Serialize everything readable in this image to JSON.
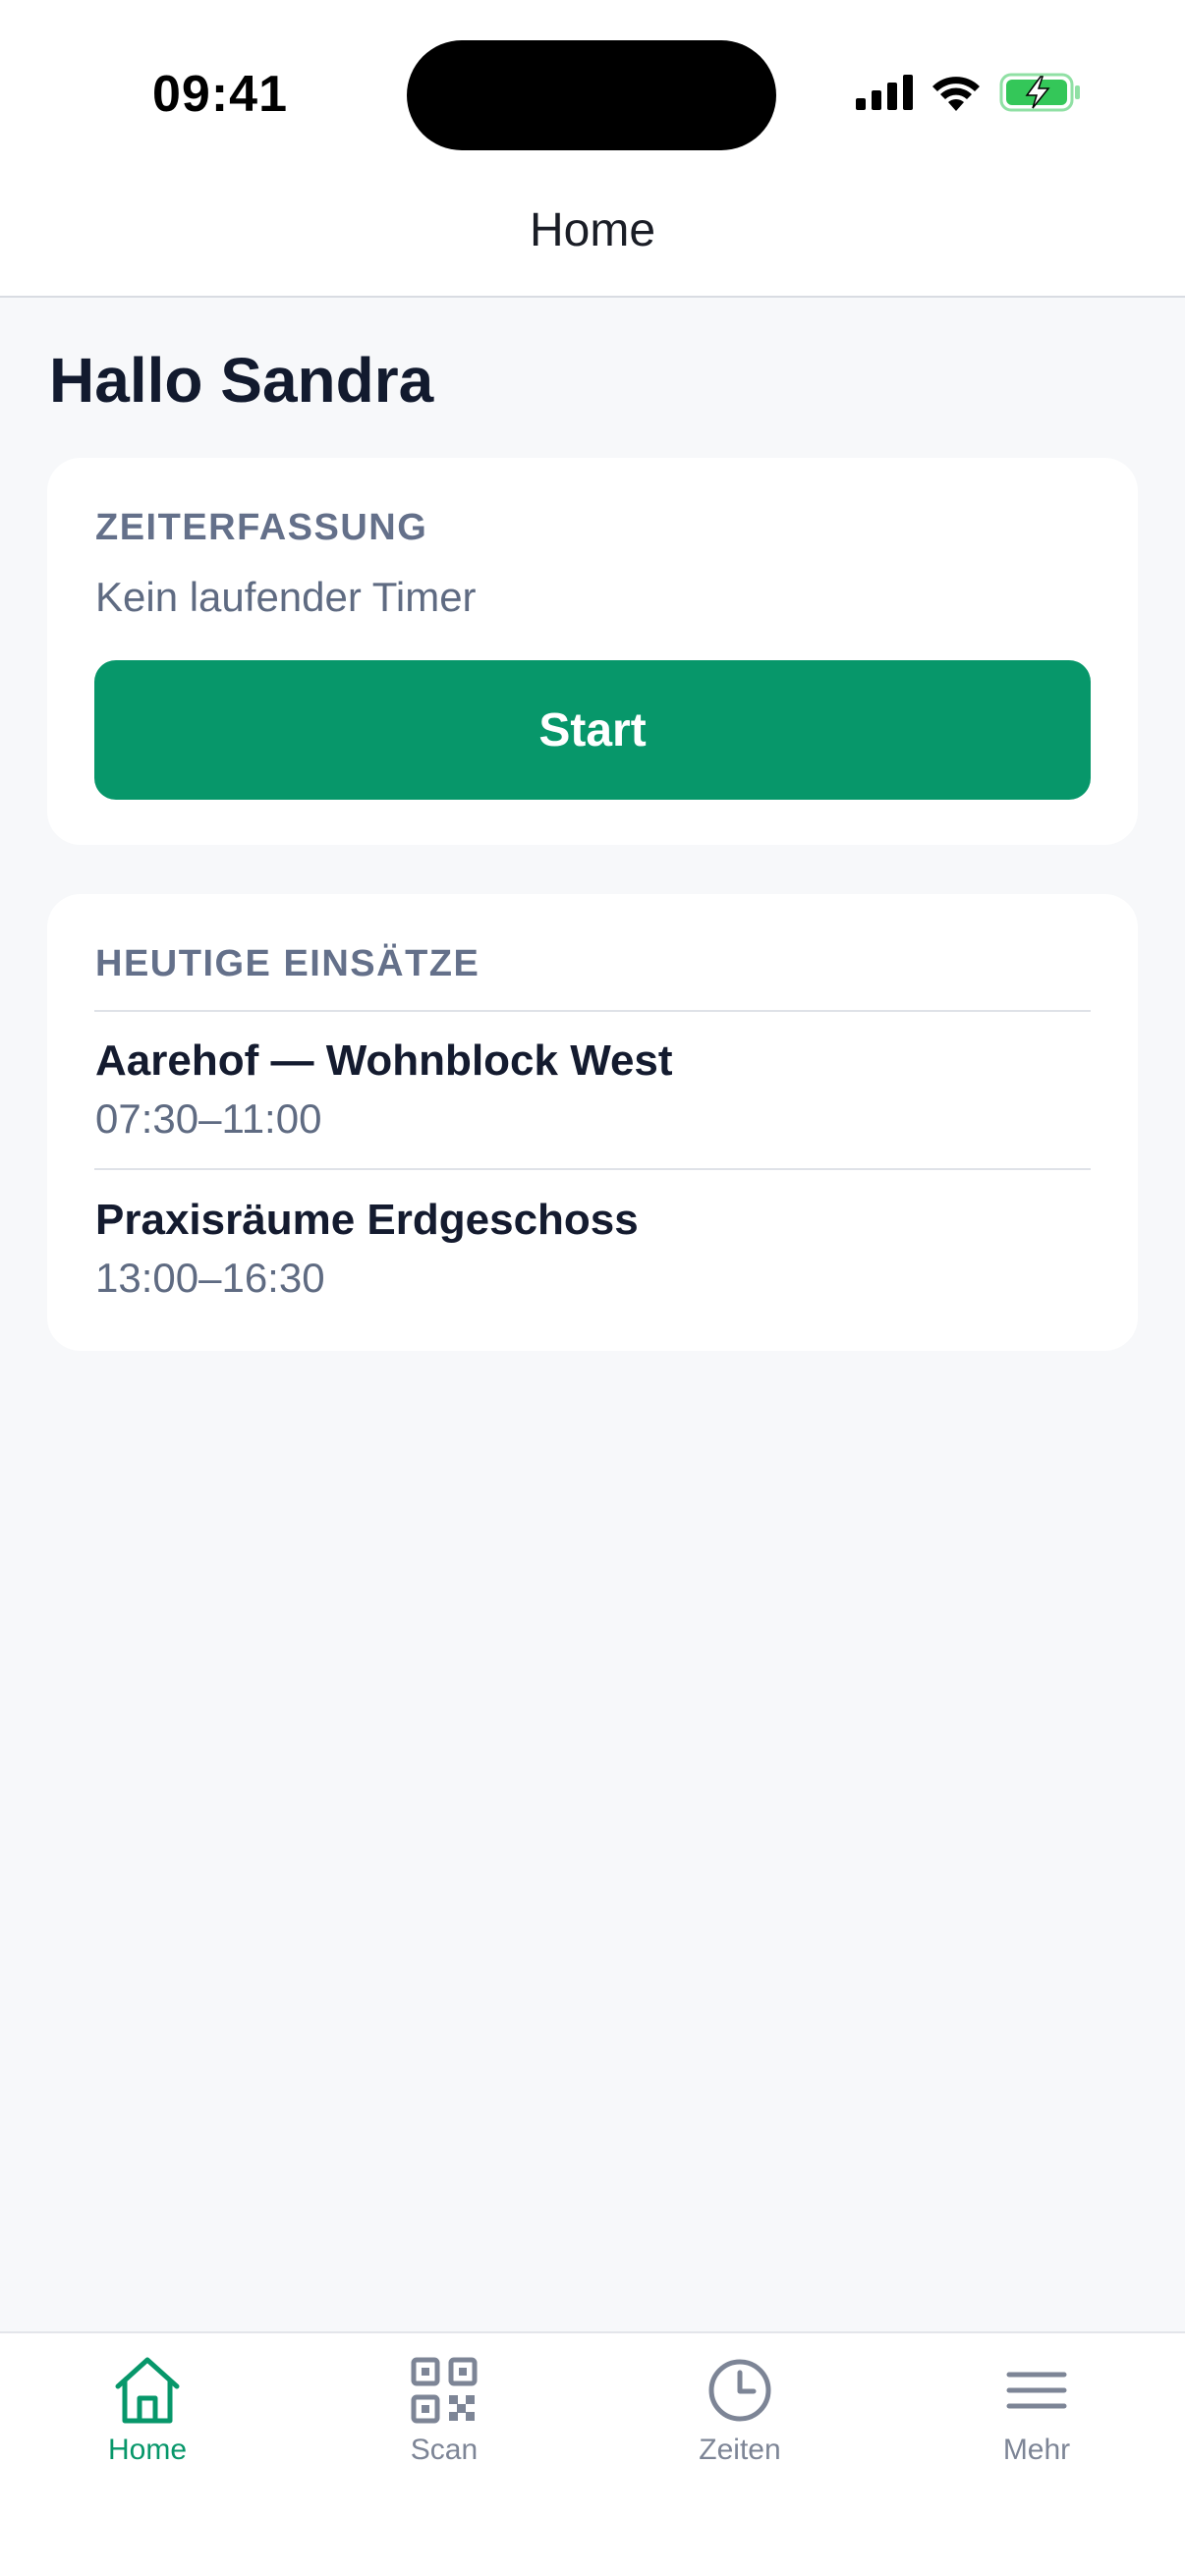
{
  "status_bar": {
    "time": "09:41"
  },
  "nav": {
    "title": "Home"
  },
  "greeting": "Hallo Sandra",
  "time_tracking": {
    "label": "ZEITERFASSUNG",
    "status": "Kein laufender Timer",
    "start_label": "Start"
  },
  "jobs": {
    "label": "HEUTIGE EINSÄTZE",
    "items": [
      {
        "title": "Aarehof — Wohnblock West",
        "time": "07:30–11:00"
      },
      {
        "title": "Praxisräume Erdgeschoss",
        "time": "13:00–16:30"
      }
    ]
  },
  "tabs": [
    {
      "label": "Home",
      "icon": "home-icon",
      "active": true
    },
    {
      "label": "Scan",
      "icon": "qr-code-icon",
      "active": false
    },
    {
      "label": "Zeiten",
      "icon": "clock-icon",
      "active": false
    },
    {
      "label": "Mehr",
      "icon": "menu-icon",
      "active": false
    }
  ],
  "colors": {
    "accent": "#07976a",
    "background": "#f7f8fa",
    "card": "#ffffff",
    "muted_text": "#64708a",
    "battery_fill": "#34c759"
  }
}
